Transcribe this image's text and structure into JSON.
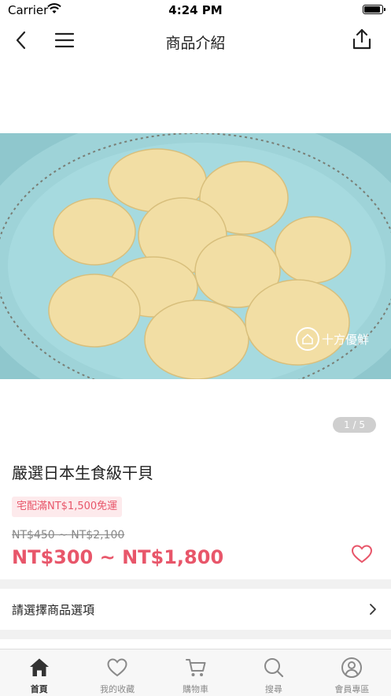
{
  "status_bar": {
    "carrier": "Carrier",
    "time": "4:24 PM"
  },
  "nav": {
    "title": "商品介紹",
    "back_icon": "chevron-left-icon",
    "menu_icon": "hamburger-menu-icon",
    "share_icon": "share-icon"
  },
  "image": {
    "watermark": "十方優鮮",
    "pager": "1 / 5"
  },
  "product": {
    "title": "嚴選日本生食級干貝",
    "promo": "宅配滿NT$1,500免運",
    "original_price": "NT$450 ~ NT$2,100",
    "sale_price": "NT$300 ~ NT$1,800",
    "favorite_icon": "heart-outline-icon"
  },
  "options": {
    "label": "請選擇商品選項"
  },
  "tabs": [
    {
      "label": "首頁",
      "icon": "home-icon",
      "active": true
    },
    {
      "label": "我的收藏",
      "icon": "heart-icon",
      "active": false
    },
    {
      "label": "購物車",
      "icon": "cart-icon",
      "active": false
    },
    {
      "label": "搜尋",
      "icon": "search-icon",
      "active": false
    },
    {
      "label": "會員專區",
      "icon": "user-icon",
      "active": false
    }
  ],
  "colors": {
    "accent": "#e8566a",
    "promo_bg": "#fdeaec",
    "plate": "#8fcad0",
    "scallop": "#f1dc9f"
  }
}
